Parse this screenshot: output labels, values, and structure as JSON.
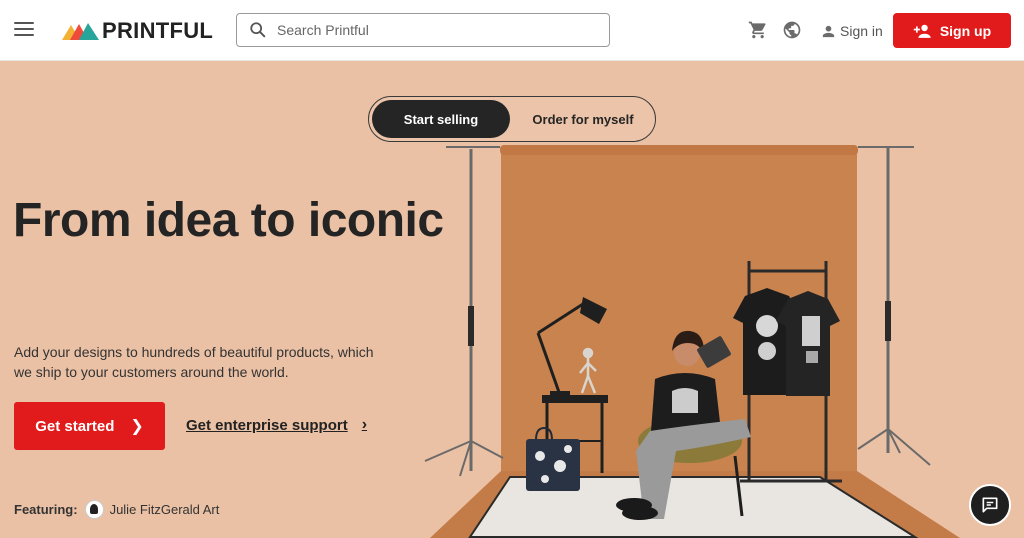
{
  "header": {
    "logo_text": "PRINTFUL",
    "search_placeholder": "Search Printful",
    "sign_in_label": "Sign in",
    "sign_up_label": "Sign up",
    "icons": [
      "menu-icon",
      "search-icon",
      "cart-icon",
      "globe-icon",
      "user-icon",
      "user-plus-icon"
    ]
  },
  "hero": {
    "toggle": {
      "active_label": "Start selling",
      "inactive_label": "Order for myself"
    },
    "headline": "From idea to iconic",
    "subtext": "Add your designs to hundreds of beautiful products, which we ship to your customers around the world.",
    "cta_primary": "Get started",
    "cta_secondary": "Get enterprise support",
    "featuring_label": "Featuring:",
    "featuring_name": "Julie FitzGerald Art"
  },
  "colors": {
    "brand_red": "#e11b1b",
    "hero_bg": "#ebc1a5",
    "backdrop": "#c8834f",
    "dark": "#252525"
  }
}
